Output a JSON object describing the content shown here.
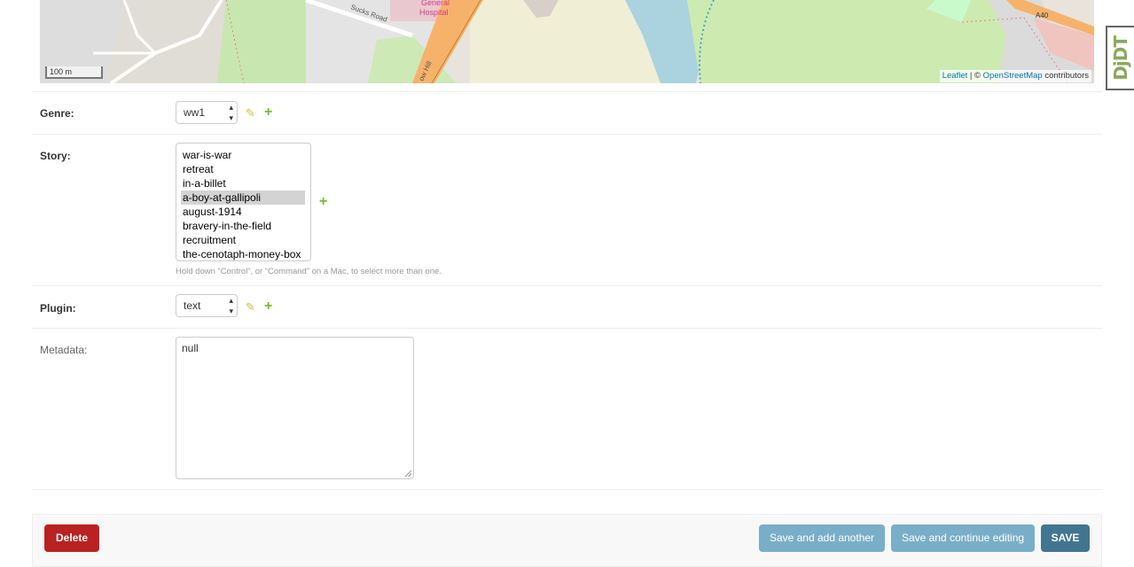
{
  "map": {
    "scale_label": "100 m",
    "attribution": {
      "leaflet": "Leaflet",
      "separator": " | © ",
      "osm": "OpenStreetMap",
      "suffix": " contributors"
    },
    "labels": {
      "hospital_line1": "General",
      "hospital_line2": "Hospital",
      "road": "Sucks Road",
      "hill": "ow Hill",
      "a40": "A40"
    }
  },
  "debug_toolbar": {
    "label": "DjDT"
  },
  "form": {
    "genre": {
      "label": "Genre:",
      "value": "ww1"
    },
    "story": {
      "label": "Story:",
      "options": [
        "war-is-war",
        "retreat",
        "in-a-billet",
        "a-boy-at-gallipoli",
        "august-1914",
        "bravery-in-the-field",
        "recruitment",
        "the-cenotaph-money-box"
      ],
      "selected_index": 3,
      "help_text": "Hold down “Control”, or “Command” on a Mac, to select more than one."
    },
    "plugin": {
      "label": "Plugin:",
      "value": "text"
    },
    "metadata": {
      "label": "Metadata:",
      "value": "null"
    }
  },
  "actions": {
    "delete": "Delete",
    "save_add_another": "Save and add another",
    "save_continue": "Save and continue editing",
    "save": "SAVE"
  },
  "colors": {
    "delete": "#ba2121",
    "secondary_button": "#79aec8",
    "primary_button": "#417690",
    "add_icon": "#70bf2b",
    "edit_icon": "#e4b634"
  }
}
